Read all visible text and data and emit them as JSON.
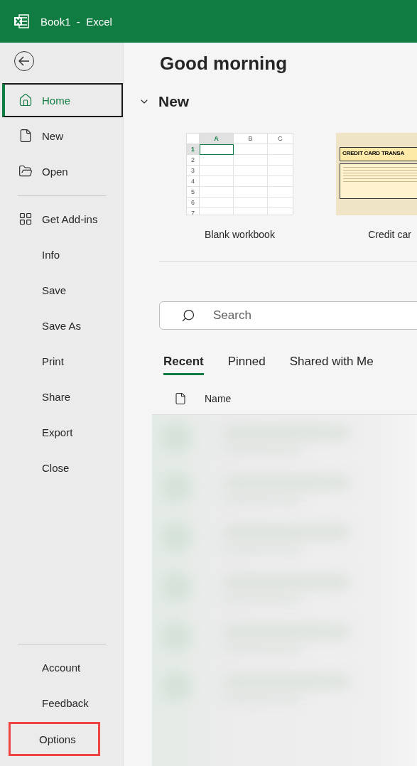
{
  "window": {
    "title": "Book1  -  Excel"
  },
  "sidebar": {
    "top_items": [
      {
        "label": "Home",
        "selected": true
      },
      {
        "label": "New",
        "selected": false
      },
      {
        "label": "Open",
        "selected": false
      }
    ],
    "main_items": [
      {
        "label": "Get Add-ins",
        "selected": false
      },
      {
        "label": "Info",
        "selected": false
      },
      {
        "label": "Save",
        "selected": false
      },
      {
        "label": "Save As",
        "selected": false
      },
      {
        "label": "Print",
        "selected": false
      },
      {
        "label": "Share",
        "selected": false
      },
      {
        "label": "Export",
        "selected": false
      },
      {
        "label": "Close",
        "selected": false
      }
    ],
    "bottom_items": [
      {
        "label": "Account",
        "selected": false,
        "highlighted": false
      },
      {
        "label": "Feedback",
        "selected": false,
        "highlighted": false
      },
      {
        "label": "Options",
        "selected": false,
        "highlighted": true
      }
    ]
  },
  "greeting": "Good morning",
  "new_section": {
    "title": "New",
    "expanded": true,
    "templates": [
      {
        "kind": "blank",
        "label": "Blank workbook",
        "columns": [
          "A",
          "B",
          "C"
        ],
        "rows": [
          "1",
          "2",
          "3",
          "4",
          "5",
          "6",
          "7"
        ]
      },
      {
        "kind": "document",
        "label": "Credit car",
        "heading": "CREDIT CARD TRANSA"
      }
    ]
  },
  "search": {
    "placeholder": "Search"
  },
  "tabs": [
    {
      "label": "Recent",
      "selected": true
    },
    {
      "label": "Pinned",
      "selected": false
    },
    {
      "label": "Shared with Me",
      "selected": false
    }
  ],
  "file_list": {
    "columns": [
      "Name"
    ]
  }
}
